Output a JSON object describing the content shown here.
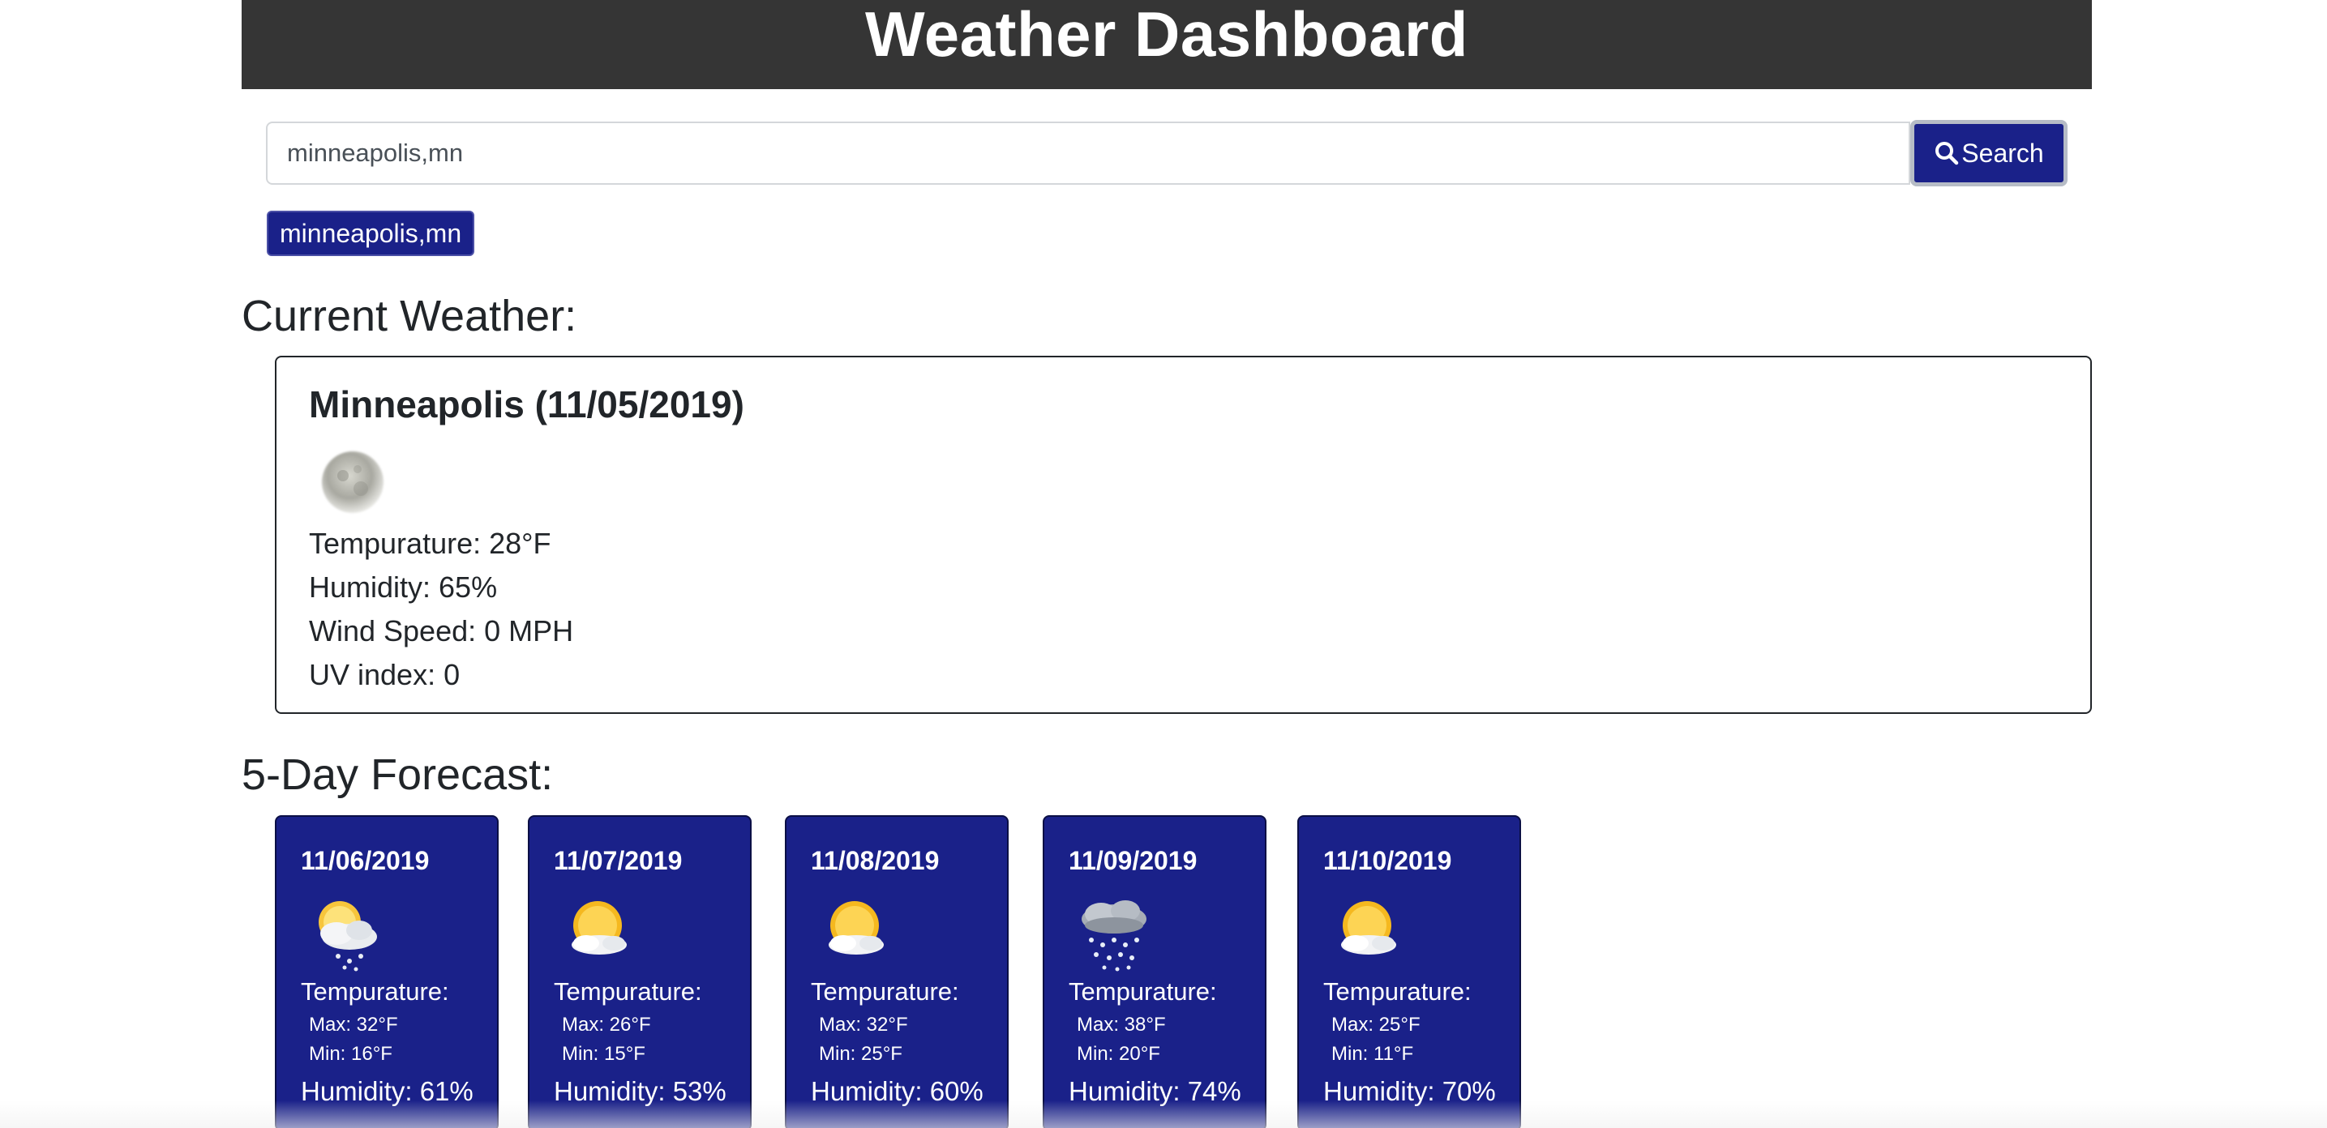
{
  "header": {
    "title": "Weather Dashboard"
  },
  "search": {
    "value": "minneapolis,mn",
    "button_label": "Search",
    "icon": "search-icon"
  },
  "history": [
    "minneapolis,mn"
  ],
  "current": {
    "section_title": "Current Weather:",
    "city_date": "Minneapolis (11/05/2019)",
    "icon": "moon-icon",
    "temperature": "Tempurature: 28°F",
    "humidity": "Humidity: 65%",
    "wind": "Wind Speed: 0 MPH",
    "uv": "UV index: 0"
  },
  "forecast": {
    "section_title": "5-Day Forecast:",
    "days": [
      {
        "date": "11/06/2019",
        "icon": "partly-cloudy-snow-icon",
        "temp_label": "Tempurature:",
        "max": "Max: 32°F",
        "min": "Min: 16°F",
        "humidity": "Humidity: 61%"
      },
      {
        "date": "11/07/2019",
        "icon": "partly-sunny-icon",
        "temp_label": "Tempurature:",
        "max": "Max: 26°F",
        "min": "Min: 15°F",
        "humidity": "Humidity: 53%"
      },
      {
        "date": "11/08/2019",
        "icon": "partly-sunny-icon",
        "temp_label": "Tempurature:",
        "max": "Max: 32°F",
        "min": "Min: 25°F",
        "humidity": "Humidity: 60%"
      },
      {
        "date": "11/09/2019",
        "icon": "snow-cloud-icon",
        "temp_label": "Tempurature:",
        "max": "Max: 38°F",
        "min": "Min: 20°F",
        "humidity": "Humidity: 74%"
      },
      {
        "date": "11/10/2019",
        "icon": "partly-sunny-icon",
        "temp_label": "Tempurature:",
        "max": "Max: 25°F",
        "min": "Min: 11°F",
        "humidity": "Humidity: 70%"
      }
    ]
  },
  "colors": {
    "header_bg": "#353535",
    "accent": "#1a2189",
    "text": "#212529"
  }
}
